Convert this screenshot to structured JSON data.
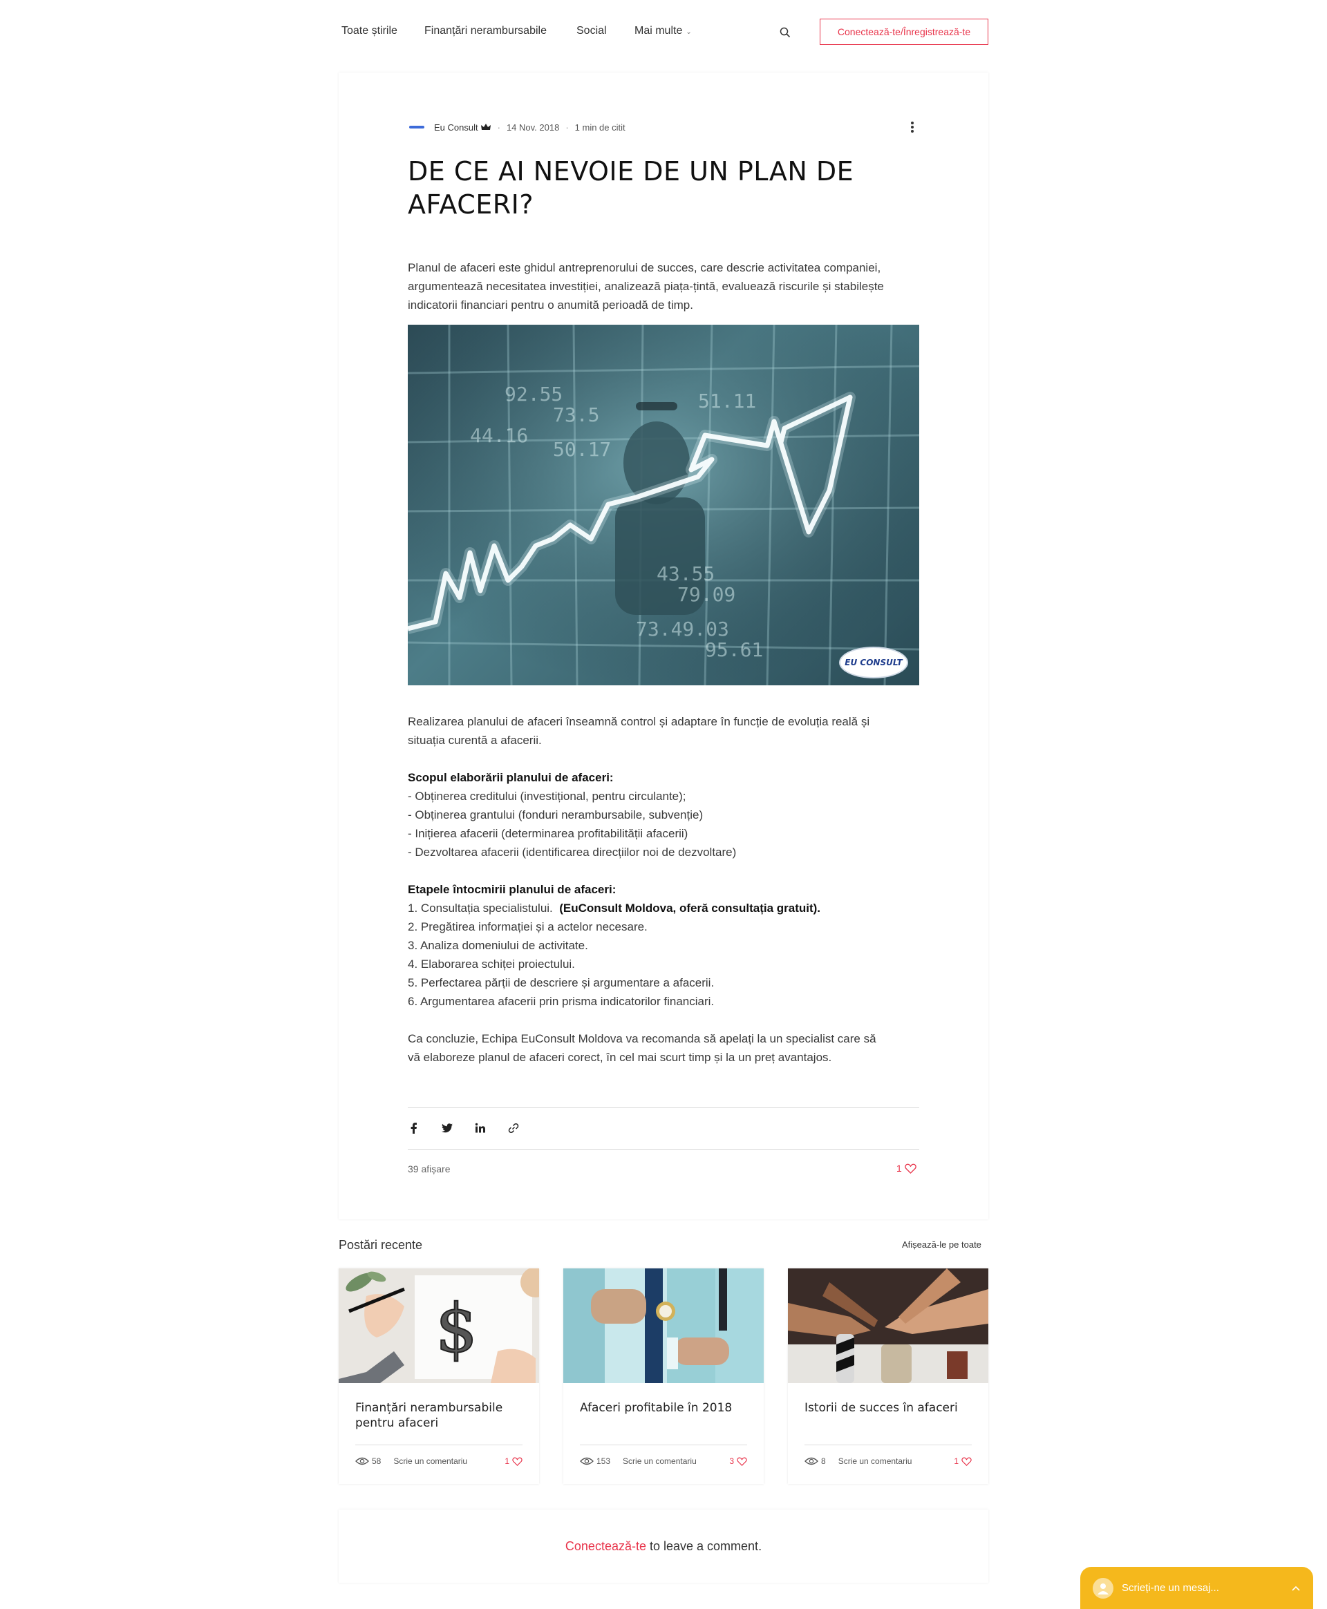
{
  "nav": {
    "items": [
      "Toate știrile",
      "Finanțări nerambursabile",
      "Social",
      "Mai multe"
    ],
    "login_label": "Conectează-te/Înregistrează-te"
  },
  "post": {
    "author": "Eu Consult",
    "date": "14 Nov. 2018",
    "read_time": "1 min de citit",
    "title": "DE CE AI NEVOIE DE UN PLAN DE AFACERI?",
    "intro_1": "Planul de afaceri este ghidul antreprenorului de succes, care descrie activitatea companiei,",
    "intro_2": "argumentează necesitatea investiției, analizează piața-țintă, evaluează riscurile și stabilește",
    "intro_3": "indicatorii financiari pentru o anumită perioadă de timp.",
    "image_logo_text": "EU CONSULT",
    "body_1a": "Realizarea planului de afaceri înseamnă control și adaptare în funcție de evoluția reală și",
    "body_1b": "situația curentă a afacerii.",
    "scope_heading": "Scopul elaborării planului de afaceri:",
    "scope_items": [
      "- Obținerea creditului (investițional, pentru circulante);",
      "- Obținerea grantului (fonduri nerambursabile, subvenție)",
      "- Inițierea afacerii (determinarea profitabilității afacerii)",
      "- Dezvoltarea afacerii (identificarea direcțiilor noi de dezvoltare)"
    ],
    "steps_heading": "Etapele întocmirii planului de afaceri:",
    "step_1": "1. Consultația specialistului.",
    "step_1_bold": "(EuConsult Moldova, oferă consultația gratuit).",
    "steps": [
      "2. Pregătirea informației și a actelor necesare.",
      "3. Analiza domeniului de activitate.",
      "4. Elaborarea schiței proiectului.",
      "5. Perfectarea părții de descriere și argumentare a afacerii.",
      "6. Argumentarea afacerii prin prisma indicatorilor financiari."
    ],
    "conclusion_1": "Ca concluzie, Echipa EuConsult Moldova va recomanda să apelați la un specialist care să",
    "conclusion_2": "vă elaboreze planul de afaceri corect, în cel mai scurt timp și la un preț avantajos.",
    "views": "39 afișare",
    "likes": "1"
  },
  "recent": {
    "title": "Postări recente",
    "see_all": "Afișează-le pe toate",
    "comment_label": "Scrie un comentariu",
    "posts": [
      {
        "title_1": "Finanțări nerambursabile",
        "title_2": "pentru afaceri",
        "views": "58",
        "likes": "1"
      },
      {
        "title_1": "Afaceri profitabile în 2018",
        "title_2": "",
        "views": "153",
        "likes": "3"
      },
      {
        "title_1": "Istorii de succes în afaceri",
        "title_2": "",
        "views": "8",
        "likes": "1"
      }
    ]
  },
  "comments": {
    "login_link": "Conectează-te",
    "text": "to leave a comment."
  },
  "chat": {
    "placeholder": "Scrieți-ne un mesaj..."
  },
  "colors": {
    "accent": "#e8334a",
    "chat": "#f5b81c"
  }
}
